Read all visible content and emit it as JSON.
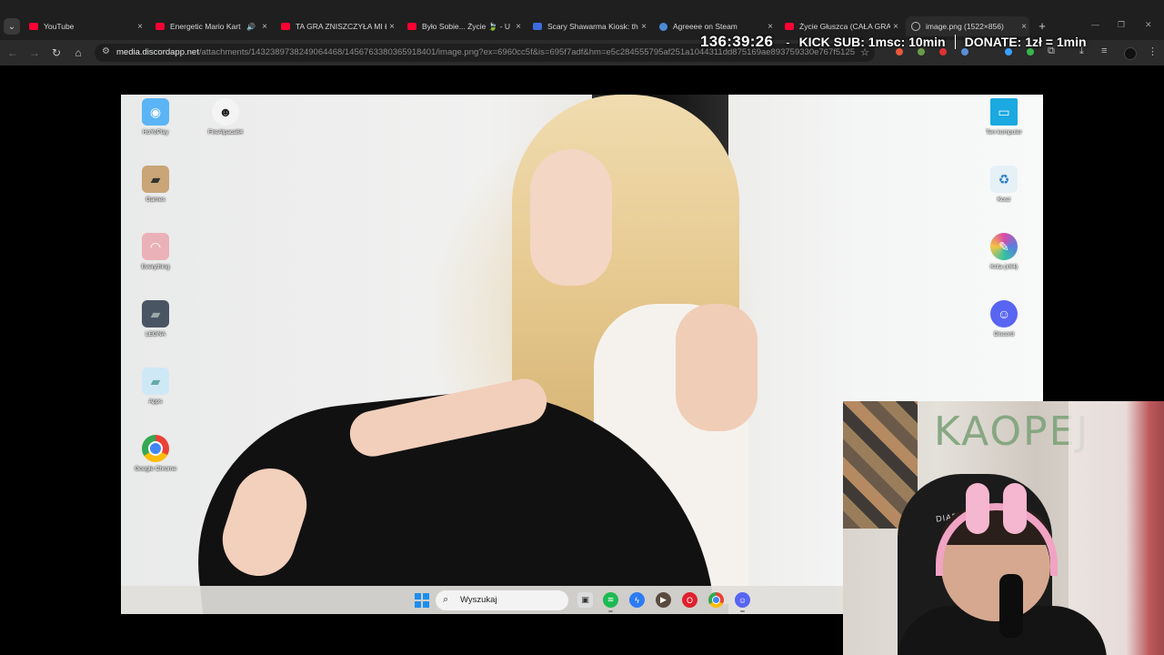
{
  "browser": {
    "tabs": [
      {
        "title": "YouTube",
        "favicon": "youtube-icon",
        "audio": false
      },
      {
        "title": "Energetic Mario Kart M",
        "favicon": "youtube-icon",
        "audio": true
      },
      {
        "title": "TA GRA ZNISZCZYŁA MI Ł",
        "favicon": "youtube-icon",
        "audio": false
      },
      {
        "title": "Było Sobie... Życie 🍃 - U",
        "favicon": "youtube-icon",
        "audio": false
      },
      {
        "title": "Scary Shawarma Kiosk: th",
        "favicon": "blue-app-icon",
        "audio": false
      },
      {
        "title": "Agreeee on Steam",
        "favicon": "steam-icon",
        "audio": false
      },
      {
        "title": "Życie Głuszca (CAŁA GRA",
        "favicon": "youtube-icon",
        "audio": false
      },
      {
        "title": "image.png (1522×856)",
        "favicon": "globe-icon",
        "audio": false,
        "active": true
      }
    ],
    "new_tab_symbol": "+",
    "close_symbol": "×",
    "url_host": "media.discordapp.net",
    "url_path": "/attachments/1432389738249064468/1456763380365918401/image.png?ex=6960cc5f&is=695f7adf&hm=e5c284555795af251a1044311dd875169ae893759330e767f51250d1...",
    "extension_colors": [
      "#e8593b",
      "#6a9a4b",
      "#d33",
      "#5a8fd6",
      "#3aa0ff",
      "#39b54a"
    ]
  },
  "overlay": {
    "timer": "136:39:26",
    "dash": "-",
    "kick_sub": "KICK SUB: 1msc: 10min",
    "donate": "DONATE: 1zł = 1min"
  },
  "desktop": {
    "left_icons": [
      {
        "label": "HoYoPlay",
        "icon": "hoyoplay-icon",
        "color": "#5bb4f5",
        "glyph": "◉"
      },
      {
        "label": "Games",
        "icon": "games-folder-icon",
        "color": "#c9a577",
        "glyph": "▰"
      },
      {
        "label": "Everything",
        "icon": "everything-icon",
        "color": "#eab2b8",
        "glyph": "◠"
      },
      {
        "label": "LEGNA",
        "icon": "legna-folder-icon",
        "color": "#4a5563",
        "glyph": "▰"
      },
      {
        "label": "Apps",
        "icon": "apps-folder-icon",
        "color": "#cfe8f5",
        "glyph": "▰"
      },
      {
        "label": "Google Chrome",
        "icon": "chrome-icon",
        "color": "#e94235",
        "glyph": "◎"
      }
    ],
    "extra_icon": {
      "label": "FireAlpaca64",
      "icon": "firealpaca-icon",
      "color": "#f4f4f4",
      "glyph": "☻"
    },
    "right_icons": [
      {
        "label": "Ten komputer",
        "icon": "this-pc-icon",
        "color": "#1aa9e0",
        "glyph": "▭"
      },
      {
        "label": "Kosz",
        "icon": "recycle-bin-icon",
        "color": "#e6f0f7",
        "glyph": "♻"
      },
      {
        "label": "Krita (x64)",
        "icon": "krita-icon",
        "color": "#d94ba8",
        "glyph": "✎"
      },
      {
        "label": "Discord",
        "icon": "discord-icon",
        "color": "#5865f2",
        "glyph": "☺"
      }
    ],
    "taskbar": {
      "search_placeholder": "Wyszukaj",
      "apps": [
        {
          "name": "task-view-icon",
          "color": "#dcdcdc",
          "glyph": "▣"
        },
        {
          "name": "spotify-icon",
          "color": "#1db954",
          "glyph": "≋"
        },
        {
          "name": "messenger-icon",
          "color": "#2d7bf4",
          "glyph": "ϟ"
        },
        {
          "name": "media-player-icon",
          "color": "#5a4a3e",
          "glyph": "▶"
        },
        {
          "name": "opera-icon",
          "color": "#e0202f",
          "glyph": "O"
        },
        {
          "name": "chrome-taskbar-icon",
          "color": "#e94235",
          "glyph": "◎"
        },
        {
          "name": "discord-taskbar-icon",
          "color": "#5865f2",
          "glyph": "☺"
        }
      ]
    }
  },
  "webcam": {
    "wall_text": "KAOPEJ",
    "chair_brand": "DIABLO"
  }
}
